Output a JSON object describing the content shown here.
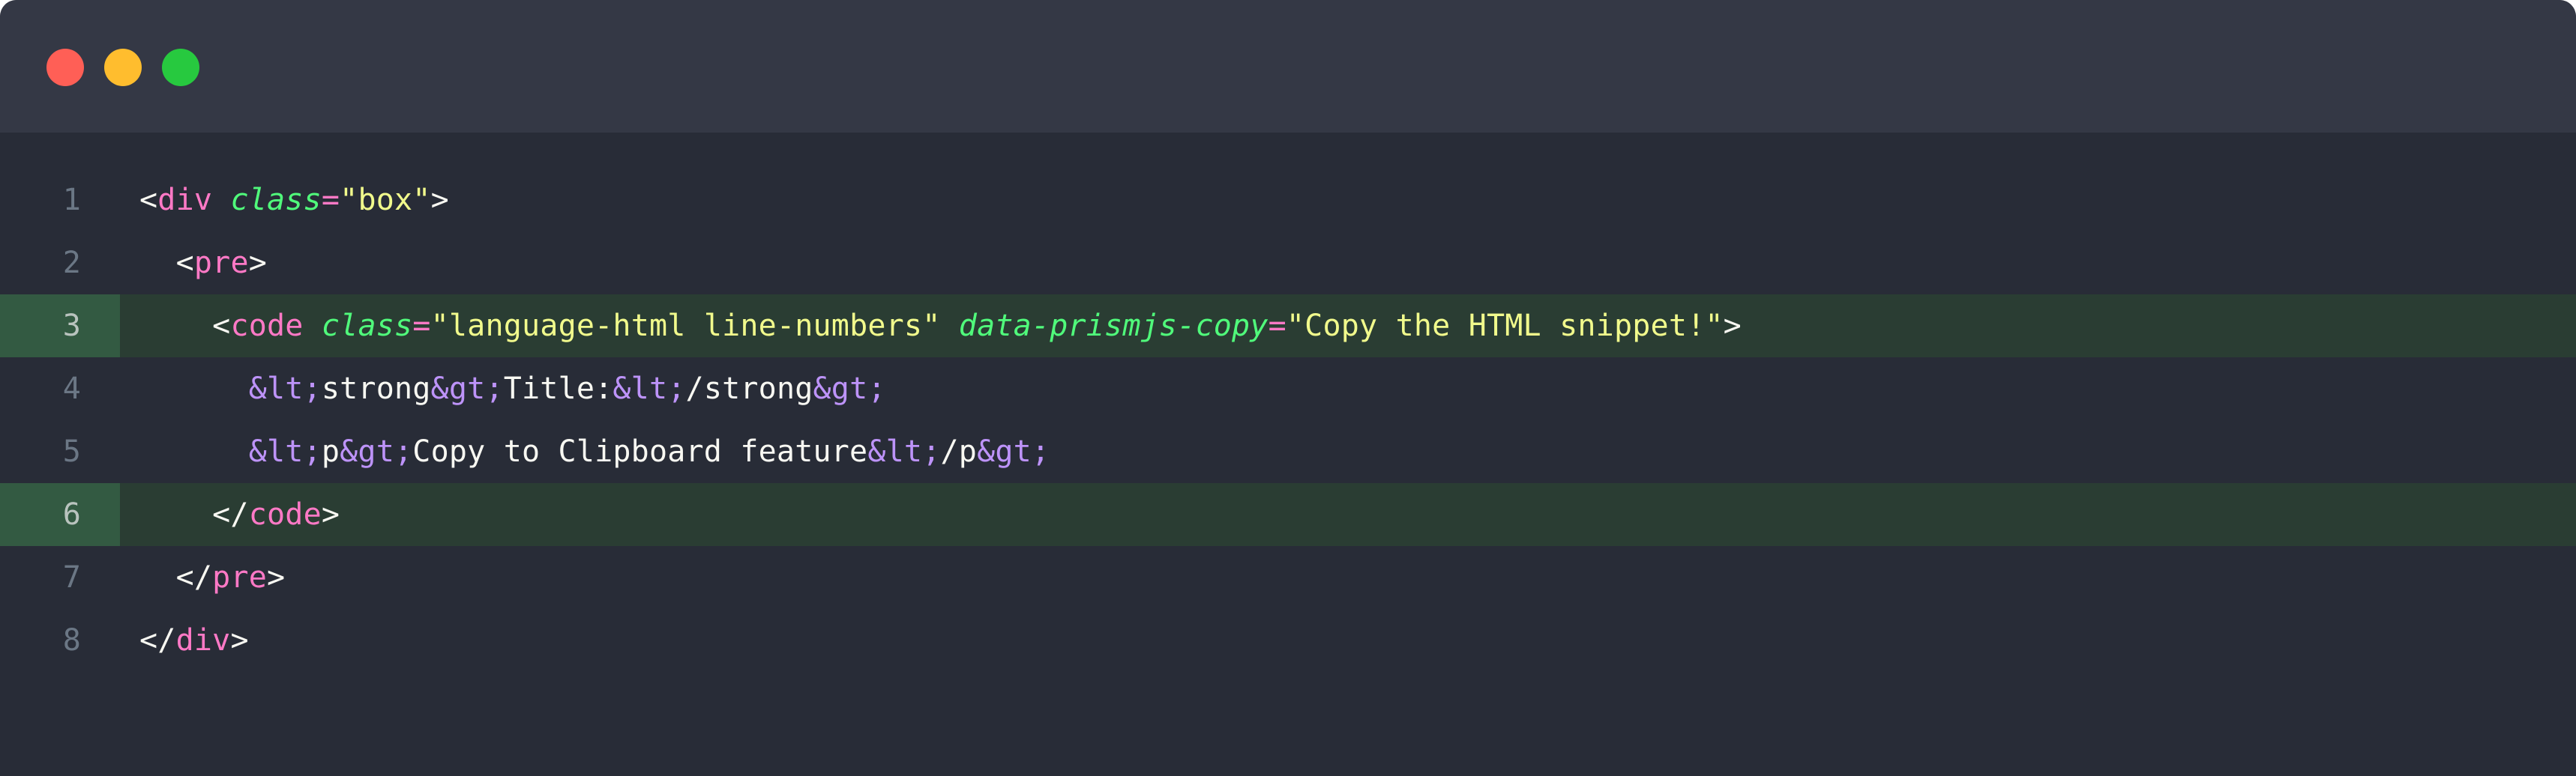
{
  "window": {
    "titlebar": {
      "buttons": [
        {
          "name": "close",
          "label": "Close",
          "color": "#ff5f56"
        },
        {
          "name": "minimize",
          "label": "Minimize",
          "color": "#ffbd2e"
        },
        {
          "name": "maximize",
          "label": "Maximize",
          "color": "#27c93f"
        }
      ]
    },
    "background": "#282c37",
    "titlebar_background": "#343845"
  },
  "editor": {
    "language": "html",
    "highlight_background": "#2a3d33",
    "highlight_gutter_background": "#335a42",
    "line_number_color": "#6b7785",
    "highlighted_lines": [
      3,
      6
    ],
    "lines": [
      {
        "number": "1",
        "highlighted": false,
        "indent": "",
        "tokens": [
          {
            "type": "punct",
            "text": "<"
          },
          {
            "type": "tag",
            "text": "div"
          },
          {
            "type": "plain",
            "text": " "
          },
          {
            "type": "attr",
            "text": "class"
          },
          {
            "type": "eq",
            "text": "="
          },
          {
            "type": "value",
            "text": "\"box\""
          },
          {
            "type": "punct",
            "text": ">"
          }
        ]
      },
      {
        "number": "2",
        "highlighted": false,
        "indent": "  ",
        "tokens": [
          {
            "type": "punct",
            "text": "<"
          },
          {
            "type": "tag",
            "text": "pre"
          },
          {
            "type": "punct",
            "text": ">"
          }
        ]
      },
      {
        "number": "3",
        "highlighted": true,
        "indent": "    ",
        "tokens": [
          {
            "type": "punct",
            "text": "<"
          },
          {
            "type": "tag",
            "text": "code"
          },
          {
            "type": "plain",
            "text": " "
          },
          {
            "type": "attr",
            "text": "class"
          },
          {
            "type": "eq",
            "text": "="
          },
          {
            "type": "value",
            "text": "\"language-html line-numbers\""
          },
          {
            "type": "plain",
            "text": " "
          },
          {
            "type": "attr",
            "text": "data-prismjs-copy"
          },
          {
            "type": "eq",
            "text": "="
          },
          {
            "type": "value",
            "text": "\"Copy the HTML snippet!\""
          },
          {
            "type": "punct",
            "text": ">"
          }
        ]
      },
      {
        "number": "4",
        "highlighted": false,
        "indent": "      ",
        "tokens": [
          {
            "type": "entity",
            "text": "&lt;"
          },
          {
            "type": "plain",
            "text": "strong"
          },
          {
            "type": "entity",
            "text": "&gt;"
          },
          {
            "type": "plain",
            "text": "Title:"
          },
          {
            "type": "entity",
            "text": "&lt;"
          },
          {
            "type": "plain",
            "text": "/strong"
          },
          {
            "type": "entity",
            "text": "&gt;"
          }
        ]
      },
      {
        "number": "5",
        "highlighted": false,
        "indent": "      ",
        "tokens": [
          {
            "type": "entity",
            "text": "&lt;"
          },
          {
            "type": "plain",
            "text": "p"
          },
          {
            "type": "entity",
            "text": "&gt;"
          },
          {
            "type": "plain",
            "text": "Copy to Clipboard feature"
          },
          {
            "type": "entity",
            "text": "&lt;"
          },
          {
            "type": "plain",
            "text": "/p"
          },
          {
            "type": "entity",
            "text": "&gt;"
          }
        ]
      },
      {
        "number": "6",
        "highlighted": true,
        "indent": "    ",
        "tokens": [
          {
            "type": "punct",
            "text": "</"
          },
          {
            "type": "tag",
            "text": "code"
          },
          {
            "type": "punct",
            "text": ">"
          }
        ]
      },
      {
        "number": "7",
        "highlighted": false,
        "indent": "  ",
        "tokens": [
          {
            "type": "punct",
            "text": "</"
          },
          {
            "type": "tag",
            "text": "pre"
          },
          {
            "type": "punct",
            "text": ">"
          }
        ]
      },
      {
        "number": "8",
        "highlighted": false,
        "indent": "",
        "tokens": [
          {
            "type": "punct",
            "text": "</"
          },
          {
            "type": "tag",
            "text": "div"
          },
          {
            "type": "punct",
            "text": ">"
          }
        ]
      }
    ]
  }
}
